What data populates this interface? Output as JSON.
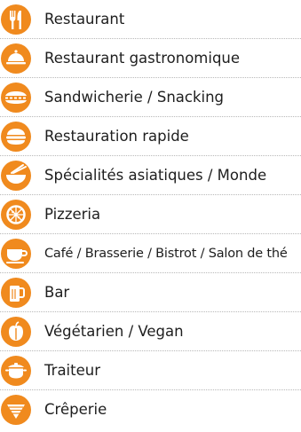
{
  "accent_color": "#f08a1e",
  "categories": [
    {
      "label": "Restaurant",
      "icon": "fork-knife-icon"
    },
    {
      "label": "Restaurant gastronomique",
      "icon": "cloche-icon"
    },
    {
      "label": "Sandwicherie / Snacking",
      "icon": "sandwich-icon"
    },
    {
      "label": "Restauration rapide",
      "icon": "burger-icon"
    },
    {
      "label": "Spécialités asiatiques / Monde",
      "icon": "asian-bowl-icon"
    },
    {
      "label": "Pizzeria",
      "icon": "pizza-icon"
    },
    {
      "label": "Café / Brasserie / Bistrot / Salon de thé",
      "icon": "coffee-cup-icon"
    },
    {
      "label": "Bar",
      "icon": "beer-mug-icon"
    },
    {
      "label": "Végétarien / Vegan",
      "icon": "apple-icon"
    },
    {
      "label": "Traiteur",
      "icon": "pot-icon"
    },
    {
      "label": "Crêperie",
      "icon": "crepe-icon"
    }
  ]
}
